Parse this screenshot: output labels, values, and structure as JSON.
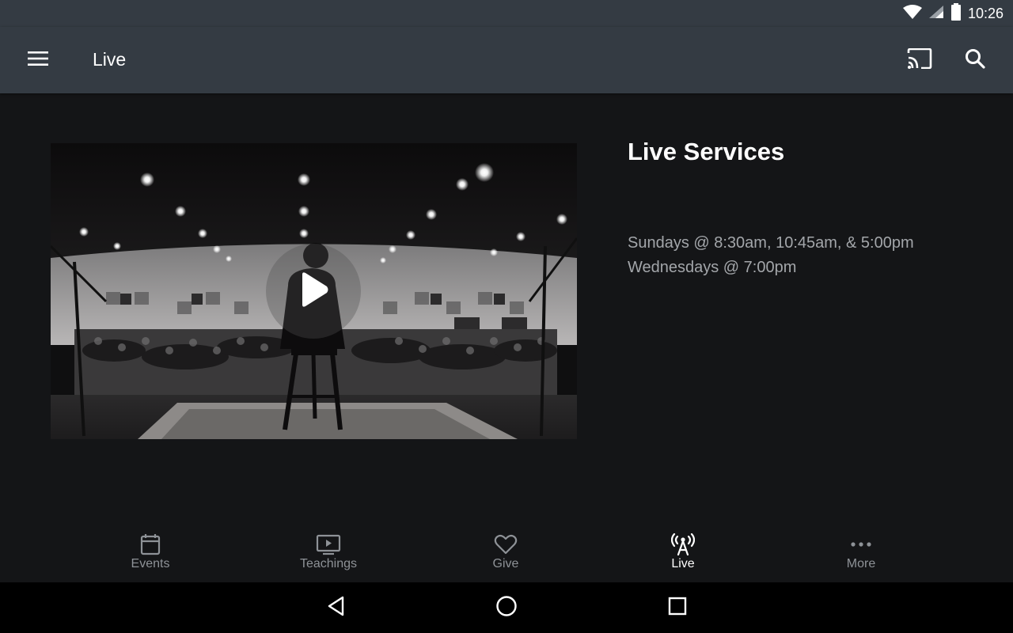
{
  "status_bar": {
    "time": "10:26"
  },
  "app_bar": {
    "title": "Live"
  },
  "live": {
    "heading": "Live Services",
    "schedule": [
      "Sundays @ 8:30am, 10:45am, & 5:00pm",
      "Wednesdays @ 7:00pm"
    ]
  },
  "bottom_nav": {
    "items": [
      {
        "label": "Events",
        "icon": "calendar-icon"
      },
      {
        "label": "Teachings",
        "icon": "tv-play-icon"
      },
      {
        "label": "Give",
        "icon": "heart-icon"
      },
      {
        "label": "Live",
        "icon": "broadcast-tower-icon",
        "active": true
      },
      {
        "label": "More",
        "icon": "more-dots-icon"
      }
    ]
  },
  "colors": {
    "app_bar_bg": "#343b43",
    "page_bg": "#141517",
    "nav_label": "#8e9297",
    "nav_label_active": "#ffffff",
    "schedule_text": "#a3a6aa"
  }
}
